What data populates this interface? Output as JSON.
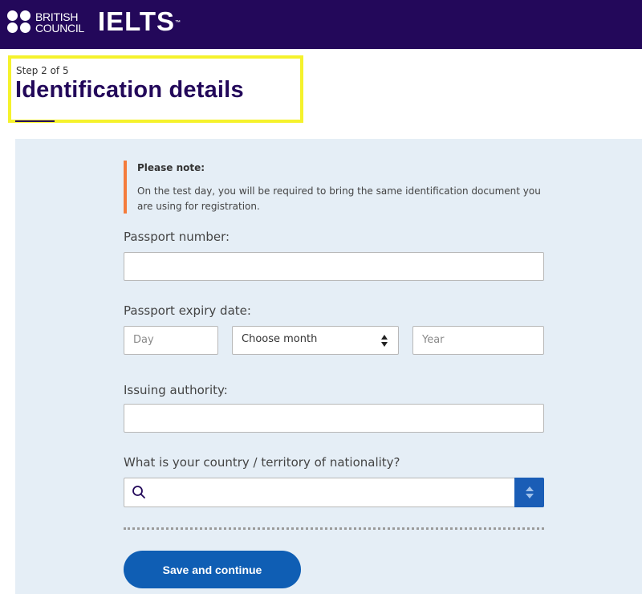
{
  "header": {
    "brand_line1": "BRITISH",
    "brand_line2": "COUNCIL",
    "product": "IELTS",
    "trademark": "™",
    "colors": {
      "bar": "#23085a"
    }
  },
  "page": {
    "step": "Step 2 of 5",
    "title": "Identification details"
  },
  "note": {
    "title": "Please note:",
    "body": "On the test day, you will be required to bring the same identification document you are using for registration.",
    "accent": "#f47c3c"
  },
  "form": {
    "passport_number": {
      "label": "Passport number:",
      "value": ""
    },
    "expiry": {
      "label": "Passport expiry date:",
      "day_placeholder": "Day",
      "month_selected": "Choose month",
      "year_placeholder": "Year"
    },
    "issuing_authority": {
      "label": "Issuing authority:",
      "value": ""
    },
    "nationality": {
      "label": "What is your country / territory of nationality?",
      "value": "",
      "icon": "search-icon"
    }
  },
  "actions": {
    "save_label": "Save and continue",
    "button_color": "#0f5eb4"
  }
}
